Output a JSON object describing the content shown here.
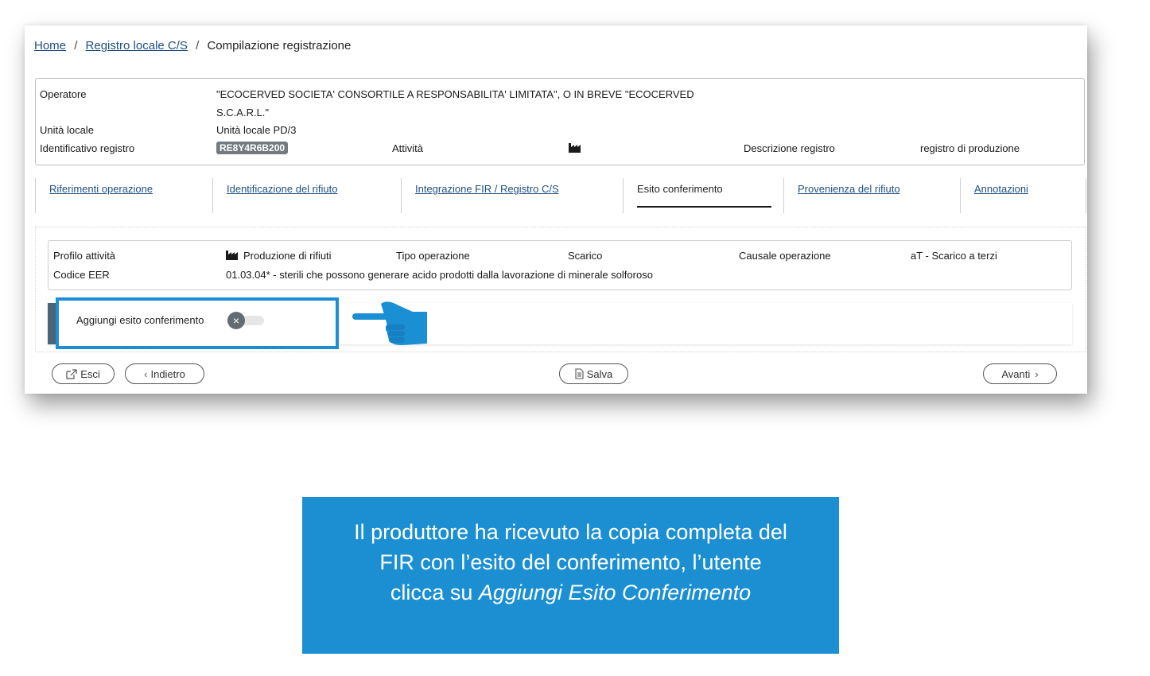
{
  "breadcrumb": {
    "home": "Home",
    "separator": "/",
    "registro": "Registro locale C/S",
    "current": "Compilazione registrazione"
  },
  "info": {
    "operatore_label": "Operatore",
    "operatore_line1": "\"ECOCERVED SOCIETA' CONSORTILE A RESPONSABILITA' LIMITATA\", O IN BREVE \"ECOCERVED",
    "operatore_line2": "S.C.A.R.L.\"",
    "unita_label": "Unità locale",
    "unita_value": "Unità locale PD/3",
    "identificativo_label": "Identificativo registro",
    "identificativo_value": "RE8Y4R6B200",
    "attivita_label": "Attività",
    "attivita_icon": "factory-icon",
    "descrizione_label": "Descrizione registro",
    "descrizione_value": "registro di produzione"
  },
  "tabs": [
    {
      "label": "Riferimenti operazione",
      "active": false
    },
    {
      "label": "Identificazione del rifiuto",
      "active": false
    },
    {
      "label": "Integrazione FIR / Registro C/S",
      "active": false
    },
    {
      "label": "Esito conferimento",
      "active": true
    },
    {
      "label": "Provenienza del rifiuto",
      "active": false
    },
    {
      "label": "Annotazioni",
      "active": false
    }
  ],
  "summary": {
    "profilo_label": "Profilo attività",
    "profilo_value": "Produzione di rifiuti",
    "tipo_label": "Tipo operazione",
    "tipo_value": "Scarico",
    "causale_label": "Causale operazione",
    "causale_value": "aT - Scarico a terzi",
    "eer_label": "Codice EER",
    "eer_value": "01.03.04* - sterili che possono generare acido prodotti dalla lavorazione di minerale solforoso"
  },
  "toggle": {
    "label": "Aggiungi esito conferimento",
    "state": "off"
  },
  "buttons": {
    "esci": "Esci",
    "indietro": "Indietro",
    "salva": "Salva",
    "avanti": "Avanti"
  },
  "callout": {
    "line1": "Il produttore ha ricevuto la copia completa del",
    "line2": "FIR con l’esito del conferimento, l’utente",
    "line3_prefix": "clicca su ",
    "line3_emphasis": "Aggiungi Esito Conferimento"
  },
  "colors": {
    "link": "#1f4f82",
    "highlight_border": "#1a8fd3",
    "callout_bg": "#1b8fd2",
    "badge_bg": "#737a80"
  }
}
